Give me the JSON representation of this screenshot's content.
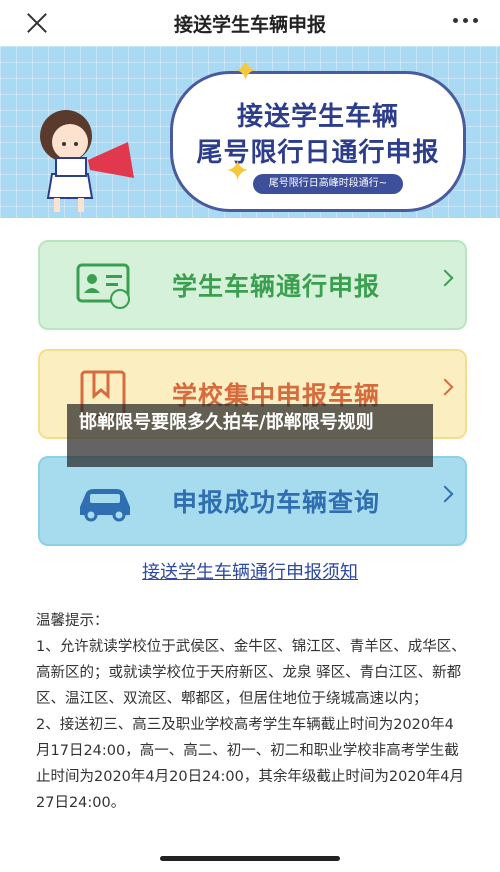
{
  "header": {
    "title": "接送学生车辆申报"
  },
  "banner": {
    "line1": "接送学生车辆",
    "line2": "尾号限行日通行申报",
    "tag": "尾号限行日高峰时段通行~"
  },
  "cards": [
    {
      "label": "学生车辆通行申报",
      "icon": "id-card-icon",
      "color": "#3a9f4f"
    },
    {
      "label": "学校集中申报车辆",
      "icon": "bookmark-icon",
      "color": "#d86b3d"
    },
    {
      "label": "申报成功车辆查询",
      "icon": "car-icon",
      "color": "#2f6fb1"
    }
  ],
  "overlay": {
    "text": "邯郸限号要限多久拍车/邯郸限号规则"
  },
  "notice_link": "接送学生车辆通行申报须知",
  "tips": {
    "heading": "温馨提示：",
    "item1": "1、允许就读学校位于武侯区、金牛区、锦江区、青羊区、成华区、高新区的；或就读学校位于天府新区、龙泉 驿区、青白江区、新都区、温江区、双流区、郫都区，但居住地位于绕城高速以内；",
    "item2": "2、接送初三、高三及职业学校高考学生车辆截止时间为2020年4月17日24:00，高一、高二、初一、初二和职业学校非高考学生截止时间为2020年4月20日24:00，其余年级截止时间为2020年4月27日24:00。"
  }
}
